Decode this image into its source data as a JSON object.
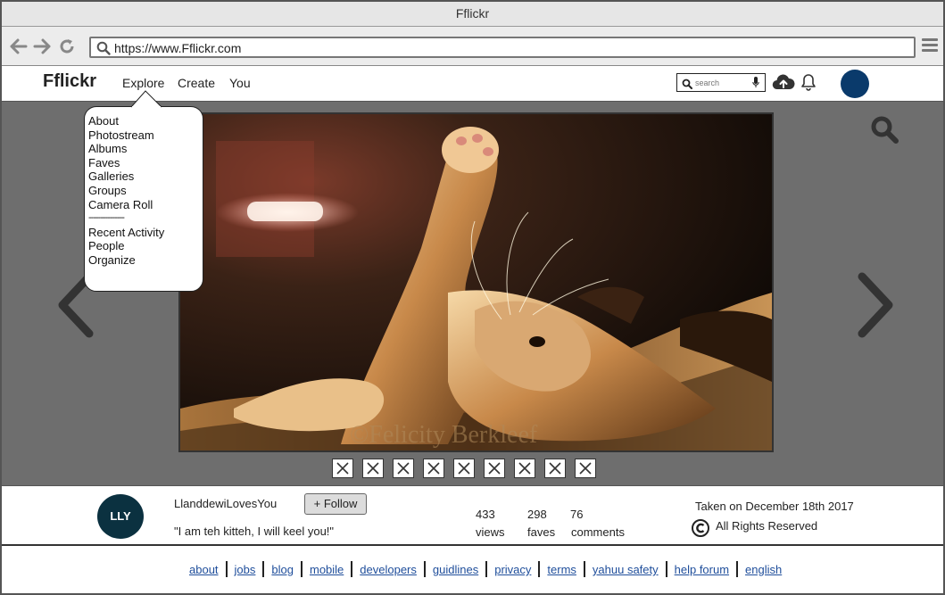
{
  "window": {
    "title": "Fflickr"
  },
  "browser": {
    "url": "https://www.Fflickr.com"
  },
  "header": {
    "logo": "Fflickr",
    "menu": [
      "Explore",
      "Create",
      "You"
    ],
    "search_placeholder": "search",
    "avatar_color": "#0a3a6b"
  },
  "explore_menu": {
    "items": [
      "About",
      "Photostream",
      "Albums",
      "Faves",
      "Galleries",
      "Groups",
      "Camera Roll"
    ],
    "separator": "---------------",
    "items2": [
      "Recent Activity",
      "People",
      "Organize"
    ]
  },
  "photo": {
    "watermark": "©Felicity Berkleef",
    "thumbnail_count": 9
  },
  "owner": {
    "avatar_text": "LLY",
    "avatar_color": "#0b3140",
    "name": "LlanddewiLovesYou",
    "follow_label": "+ Follow",
    "caption": "\"I am teh kitteh, I will keel you!\""
  },
  "stats": {
    "views_count": "433",
    "views_label": "views",
    "faves_count": "298",
    "faves_label": "faves",
    "comments_count": "76",
    "comments_label": "comments"
  },
  "meta": {
    "taken": "Taken on December 18th 2017",
    "rights": "All Rights Reserved"
  },
  "footer": {
    "links": [
      "about",
      "jobs",
      "blog",
      "mobile",
      "developers",
      "guidlines",
      "privacy",
      "terms",
      "yahuu safety",
      "help forum",
      "english"
    ]
  },
  "colors": {
    "link": "#1f4e9b",
    "stage_bg": "#6e6e6e"
  }
}
